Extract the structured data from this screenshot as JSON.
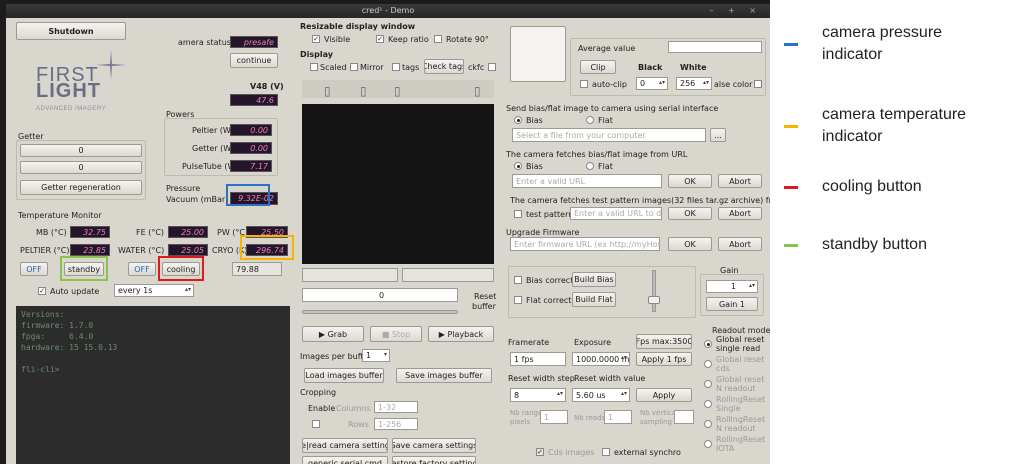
{
  "window": {
    "title": "cred¹ - Demo",
    "controls": "– + ×"
  },
  "left": {
    "shutdown": "Shutdown",
    "camera_status_label": "amera status",
    "camera_status_value": "presafe",
    "continue": "continue",
    "v48_label": "V48 (V)",
    "v48_value": "47.6",
    "logo": {
      "line1": "FIRST",
      "line2": "LIGHT",
      "line3": "ADVANCED IMAGERY"
    },
    "powers": {
      "title": "Powers",
      "peltier_label": "Peltier (W)",
      "peltier": "0.00",
      "getter_label": "Getter (W)",
      "getter": "0.00",
      "pulsetube_label": "PulseTube (W)",
      "pulsetube": "7.17"
    },
    "getter": {
      "title": "Getter",
      "value1": "0",
      "value2": "0",
      "regen": "Getter regeneration"
    },
    "pressure": {
      "title": "Pressure",
      "label": "Vacuum (mBar)",
      "value": "9.32E-02"
    },
    "temperature": {
      "title": "Temperature Monitor",
      "mb_label": "MB (°C)",
      "mb": "32.75",
      "fe_label": "FE (°C)",
      "fe": "25.00",
      "pw_label": "PW (°C)",
      "pw": "25.50",
      "peltier_label": "PELTIER (°C)",
      "peltier": "23.85",
      "water_label": "WATER (°C)",
      "water": "25.05",
      "cryo_label": "CRYO (K)",
      "cryo": "296.74",
      "off1": "OFF",
      "standby": "standby",
      "off2": "OFF",
      "cooling": "cooling",
      "setpoint": "79.88",
      "auto_update": "Auto update",
      "interval": "every 1s"
    },
    "console_text": "Versions:\nfirmware: 1.7.0\nfpga:     6.4.0\nhardware: 15 15.0.13\n\nfli-cli>"
  },
  "middle": {
    "title": "Resizable display window",
    "visible": "Visible",
    "keep_ratio": "Keep ratio",
    "rotate": "Rotate 90°",
    "display": "Display",
    "scaled": "Scaled",
    "mirror": "Mirror",
    "tags": "tags",
    "check_tags": "Check tags",
    "ckfc": "ckfc",
    "slider_value": "0",
    "reset_buffer_1": "Reset",
    "reset_buffer_2": "buffer",
    "grab": "Grab",
    "stop": "Stop",
    "playback": "Playback",
    "images_per_buffer": "Images per buffe",
    "images_value": "1",
    "load_buffer": "Load images buffer",
    "save_buffer": "Save images buffer",
    "cropping": "Cropping",
    "enable": "Enable",
    "columns": "Columns",
    "columns_val": "1-32",
    "rows": "Rows",
    "rows_val": "1-256",
    "reread": "Re|read camera settings",
    "save_settings": "Save camera settings",
    "serial_cmd": "generic serial cmd",
    "restore": "Restore factory settings"
  },
  "right": {
    "average_value": "Average value",
    "clip": "Clip",
    "black": "Black",
    "white": "White",
    "auto_clip": "auto-clip",
    "black_val": "0",
    "white_val": "256",
    "false_color": "alse color",
    "send_bias_title": "Send bias/flat image to camera using serial interface",
    "bias": "Bias",
    "flat": "Flat",
    "select_file": "Select a file from your computer",
    "browse": "...",
    "fetch_title": "The camera fetches bias/flat image from URL",
    "url_placeholder": "Enter a valid URL",
    "ok": "OK",
    "abort": "Abort",
    "test_title": "The camera fetches test pattern images(32 files tar.gz archive) from URL",
    "test_pattern": "test pattern",
    "test_url": "Enter a valid URL to d...",
    "upgrade_title": "Upgrade Firmware",
    "firmware_url": "Enter firmware URL (ex http://myHostn...",
    "bias_correction": "Bias correctic",
    "build_bias": "Build Bias",
    "flat_correction": "Flat correctio",
    "build_flat": "Build Flat",
    "gain_title": "Gain",
    "gain_value": "1",
    "gain_btn": "Gain 1",
    "framerate": "Framerate",
    "exposure": "Exposure",
    "fps_max": "Fps max:3500",
    "fps_value": "1 fps",
    "exposure_value": "1000.0000 ms",
    "apply_fps": "Apply 1 fps",
    "reset_width_step": "Reset width step",
    "reset_width_value": "Reset width value",
    "step_value": "8",
    "width_value": "5.60 us",
    "apply": "Apply",
    "nb_ranges": "Nb ranges",
    "nb_ranges_2": "pixels",
    "nb_reads": "Nb reads",
    "nb_ranges_val": "1",
    "nb_reads_val": "1",
    "nb_vertical": "Nb vertical",
    "nb_vertical_2": "sampling",
    "cds_images": "Cds images",
    "external_sync": "external synchro",
    "readout_title": "Readout mode",
    "modes": [
      "Global reset single read",
      "Global reset cds",
      "Global reset N readout",
      "RollingReset Single",
      "RollingReset N readout",
      "RollingReset IOTA"
    ]
  },
  "legend": {
    "pressure_1": "camera pressure",
    "pressure_2": "indicator",
    "temperature_1": "camera temperature",
    "temperature_2": "indicator",
    "cooling": "cooling button",
    "standby": "standby button"
  },
  "colors": {
    "pressure": "#2f72c4",
    "temperature": "#f4b400",
    "cooling": "#e0191e",
    "standby": "#8bc34a"
  }
}
